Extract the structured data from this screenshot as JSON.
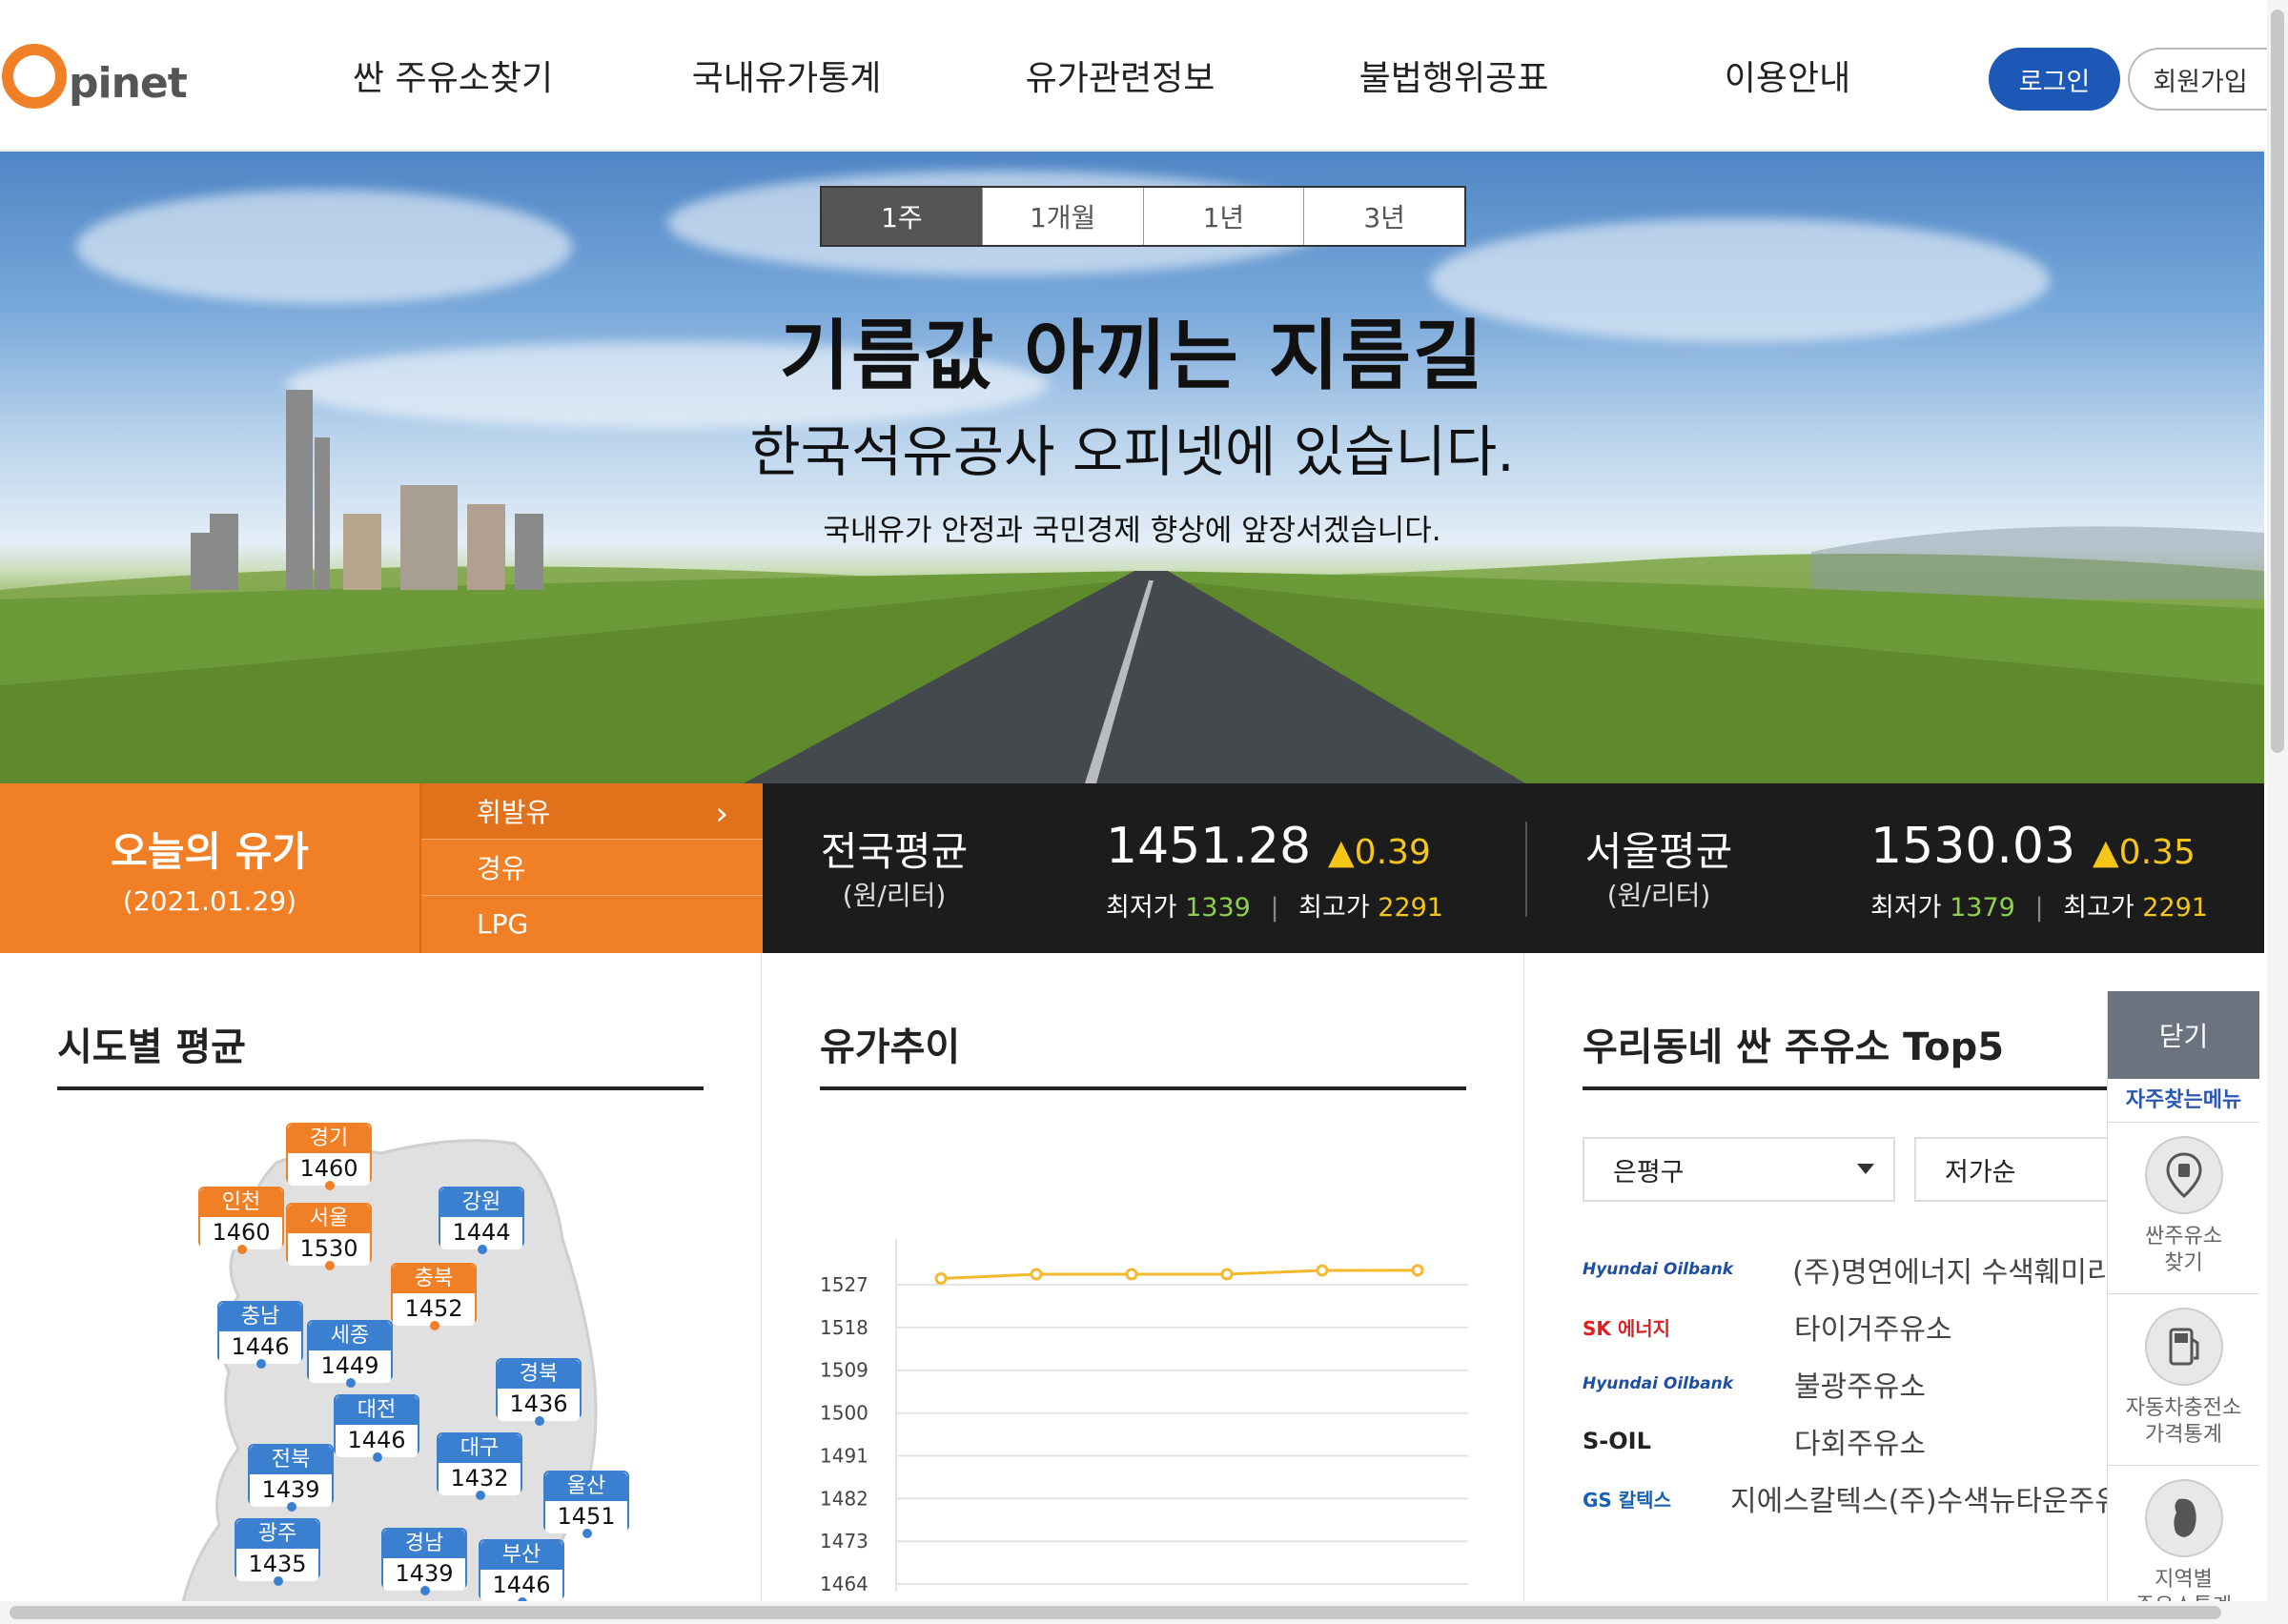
{
  "header": {
    "logo_text": "pinet",
    "nav": [
      "싼 주유소찾기",
      "국내유가통계",
      "유가관련정보",
      "불법행위공표",
      "이용안내"
    ],
    "login_label": "로그인",
    "join_label": "회원가입"
  },
  "hero": {
    "title": "기름값 아끼는 지름길",
    "subtitle": "한국석유공사 오피넷에 있습니다.",
    "description": "국내유가 안정과 국민경제 향상에 앞장서겠습니다."
  },
  "today": {
    "title": "오늘의 유가",
    "date": "(2021.01.29)",
    "fuel_tabs": [
      "휘발유",
      "경유",
      "LPG"
    ],
    "active_tab": "휘발유"
  },
  "national": {
    "label": "전국평균",
    "unit": "(원/리터)",
    "price": "1451.28",
    "change": "▲0.39",
    "min_label": "최저가",
    "min": "1339",
    "max_label": "최고가",
    "max": "2291"
  },
  "seoul": {
    "label": "서울평균",
    "unit": "(원/리터)",
    "price": "1530.03",
    "change": "▲0.35",
    "min_label": "최저가",
    "min": "1379",
    "max_label": "최고가",
    "max": "2291"
  },
  "regional": {
    "title": "시도별 평균",
    "regions": [
      {
        "name": "경기",
        "price": "1460",
        "color": "orange"
      },
      {
        "name": "인천",
        "price": "1460",
        "color": "orange"
      },
      {
        "name": "서울",
        "price": "1530",
        "color": "orange"
      },
      {
        "name": "강원",
        "price": "1444",
        "color": "blue"
      },
      {
        "name": "충북",
        "price": "1452",
        "color": "orange"
      },
      {
        "name": "충남",
        "price": "1446",
        "color": "blue"
      },
      {
        "name": "세종",
        "price": "1449",
        "color": "blue"
      },
      {
        "name": "경북",
        "price": "1436",
        "color": "blue"
      },
      {
        "name": "대전",
        "price": "1446",
        "color": "blue"
      },
      {
        "name": "전북",
        "price": "1439",
        "color": "blue"
      },
      {
        "name": "대구",
        "price": "1432",
        "color": "blue"
      },
      {
        "name": "울산",
        "price": "1451",
        "color": "blue"
      },
      {
        "name": "광주",
        "price": "1435",
        "color": "blue"
      },
      {
        "name": "경남",
        "price": "1439",
        "color": "blue"
      },
      {
        "name": "부산",
        "price": "1446",
        "color": "blue"
      }
    ]
  },
  "trend": {
    "title": "유가추이",
    "periods": [
      "1주",
      "1개월",
      "1년",
      "3년"
    ],
    "active_period": "1주"
  },
  "chart_data": {
    "type": "line",
    "title": "",
    "xlabel": "",
    "ylabel": "",
    "y_ticks": [
      1527,
      1518,
      1509,
      1500,
      1491,
      1482,
      1473,
      1464
    ],
    "ylim": [
      1464,
      1527
    ],
    "series": [
      {
        "values": [
          1528.3,
          1529.2,
          1529.2,
          1529.2,
          1530.0,
          1530.03
        ],
        "color": "#f5b92e"
      }
    ]
  },
  "top5": {
    "title": "우리동네 싼 주유소 Top5",
    "district": "은평구",
    "sort": "저가순",
    "stations": [
      {
        "brand": "Hyundai Oilbank",
        "brand_key": "hd",
        "name": "(주)명연에너지 수색훼미리주유소"
      },
      {
        "brand": "SK 에너지",
        "brand_key": "sk",
        "name": "타이거주유소"
      },
      {
        "brand": "Hyundai Oilbank",
        "brand_key": "hd",
        "name": "불광주유소"
      },
      {
        "brand": "S-OIL",
        "brand_key": "soil",
        "name": "다회주유소"
      },
      {
        "brand": "GS 칼텍스",
        "brand_key": "gs",
        "name": "지에스칼텍스(주)수색뉴타운주유소"
      }
    ]
  },
  "quick_menu": {
    "close_label": "닫기",
    "title": "자주찾는메뉴",
    "items": [
      {
        "label_1": "싼주유소",
        "label_2": "찾기",
        "icon": "fuel-pin-icon"
      },
      {
        "label_1": "자동차충전소",
        "label_2": "가격통계",
        "icon": "charger-icon"
      },
      {
        "label_1": "지역별",
        "label_2": "주유소통계",
        "icon": "korea-map-icon"
      }
    ]
  },
  "colors": {
    "brand_orange": "#f07f26",
    "brand_blue": "#1e58b7",
    "price_up": "#f5c518",
    "price_low": "#8ed14c"
  }
}
